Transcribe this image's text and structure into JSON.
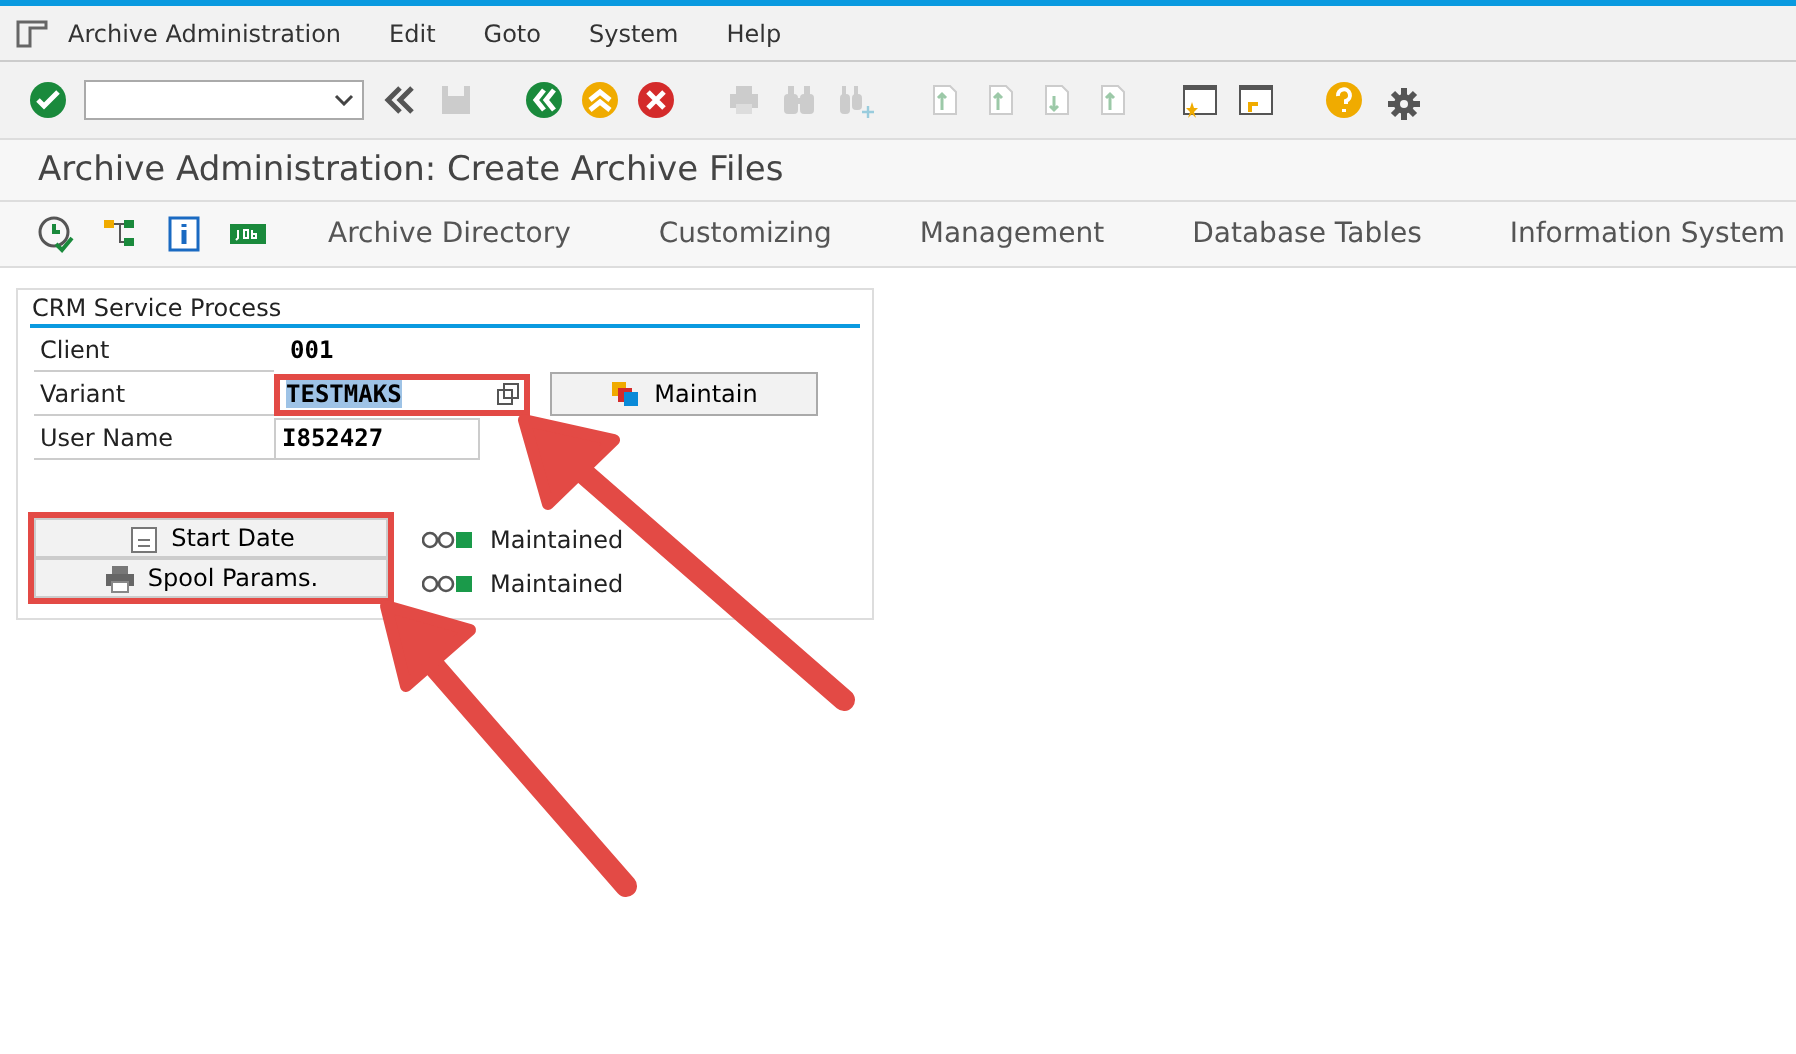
{
  "menu": [
    "Archive Administration",
    "Edit",
    "Goto",
    "System",
    "Help"
  ],
  "title": "Archive Administration: Create Archive Files",
  "app_toolbar": [
    "Archive Directory",
    "Customizing",
    "Management",
    "Database Tables",
    "Information System"
  ],
  "group": {
    "title": "CRM Service Process",
    "fields": [
      {
        "kind": "display",
        "label": "Client",
        "value": "001"
      },
      {
        "kind": "input",
        "label": "Variant",
        "value": "TESTMAKS",
        "text_selected": true,
        "highlighted": true,
        "button": "Maintain"
      },
      {
        "kind": "input",
        "label": "User Name",
        "value": "I852427",
        "text_selected": false,
        "highlighted": false
      }
    ],
    "actions": [
      {
        "kind": "calendar",
        "label": "Start Date",
        "status": "Maintained"
      },
      {
        "kind": "printer",
        "label": "Spool Params.",
        "status": "Maintained"
      }
    ],
    "actions_highlighted": true
  }
}
